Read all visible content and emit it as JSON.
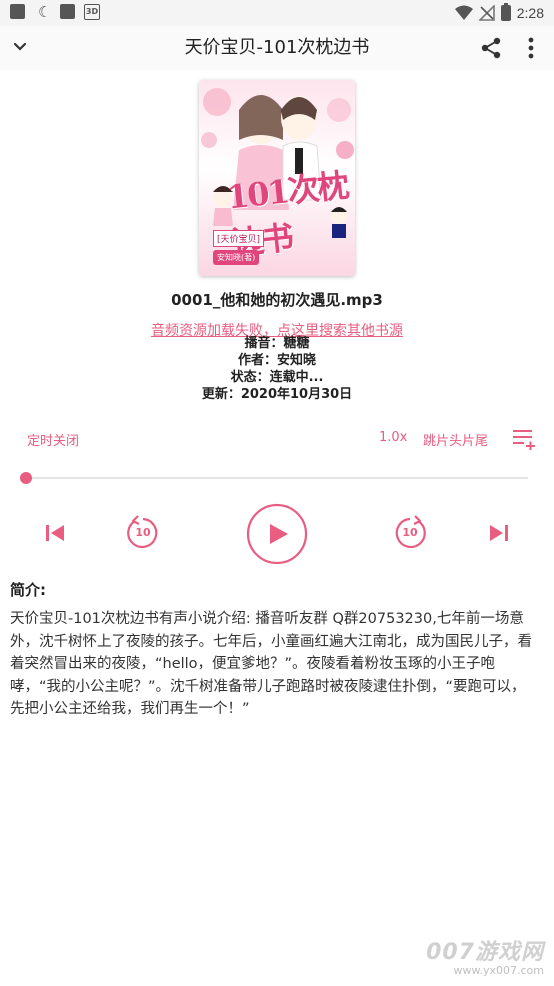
{
  "status_bar": {
    "time": "2:28",
    "badge_3d": "3D"
  },
  "app_bar": {
    "title": "天价宝贝-101次枕边书"
  },
  "cover": {
    "title_text": "101次枕边书",
    "subtitle_text": "[天价宝贝]",
    "author_text": "安知晓(著)"
  },
  "track": {
    "filename": "0001_他和她的初次遇见.mp3",
    "error_link": "音频资源加载失败，点这里搜索其他书源",
    "narrator": "播音：糖糖",
    "author": "作者：安知晓",
    "status": "状态：连载中...",
    "updated": "更新：2020年10月30日"
  },
  "controls": {
    "sleep_timer": "定时关闭",
    "speed": "1.0x",
    "skip_intro": "跳片头片尾",
    "rewind_seconds": "10",
    "forward_seconds": "10",
    "progress": 0.0
  },
  "intro": {
    "heading": "简介:",
    "text": "天价宝贝-101次枕边书有声小说介绍: 播音听友群 Q群20753230,七年前一场意外，沈千树怀上了夜陵的孩子。七年后，小童画红遍大江南北，成为国民儿子，看着突然冒出来的夜陵，“hello，便宜爹地？”。夜陵看着粉妆玉琢的小王子咆哮，“我的小公主呢？”。沈千树准备带儿子跑路时被夜陵逮住扑倒，“要跑可以，先把小公主还给我，我们再生一个！”"
  },
  "watermark": {
    "brand": "007游戏网",
    "url": "www.yx007.com"
  },
  "colors": {
    "accent": "#e85d80",
    "status_bar": "#f4f4f4"
  }
}
